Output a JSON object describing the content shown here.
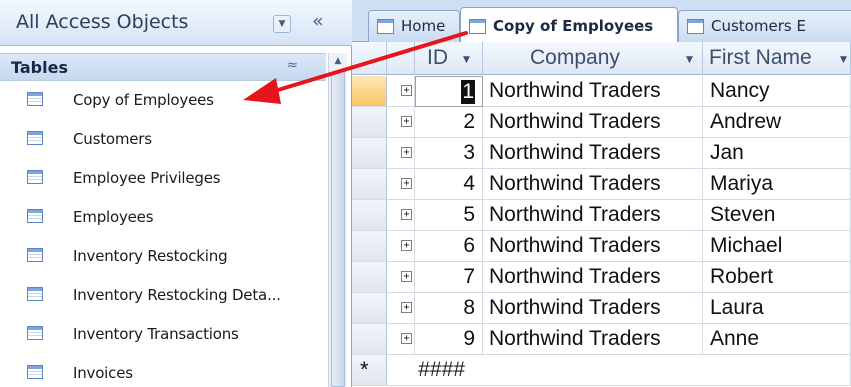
{
  "nav": {
    "title": "All Access Objects",
    "dropdown_glyph": "▼",
    "collapse_glyph": "«",
    "group": {
      "title": "Tables",
      "toggle_glyph": "≈"
    },
    "items": [
      {
        "label": "Copy of Employees"
      },
      {
        "label": "Customers"
      },
      {
        "label": "Employee Privileges"
      },
      {
        "label": "Employees"
      },
      {
        "label": "Inventory Restocking"
      },
      {
        "label": "Inventory Restocking Deta..."
      },
      {
        "label": "Inventory Transactions"
      },
      {
        "label": "Invoices"
      }
    ]
  },
  "tabs": [
    {
      "label": "Home"
    },
    {
      "label": "Copy of Employees",
      "active": true
    },
    {
      "label": "Customers E"
    }
  ],
  "datasheet": {
    "columns": [
      {
        "label": "ID"
      },
      {
        "label": "Company"
      },
      {
        "label": "First Name"
      }
    ],
    "rows": [
      {
        "id": "1",
        "company": "Northwind Traders",
        "first_name": "Nancy"
      },
      {
        "id": "2",
        "company": "Northwind Traders",
        "first_name": "Andrew"
      },
      {
        "id": "3",
        "company": "Northwind Traders",
        "first_name": "Jan"
      },
      {
        "id": "4",
        "company": "Northwind Traders",
        "first_name": "Mariya"
      },
      {
        "id": "5",
        "company": "Northwind Traders",
        "first_name": "Steven"
      },
      {
        "id": "6",
        "company": "Northwind Traders",
        "first_name": "Michael"
      },
      {
        "id": "7",
        "company": "Northwind Traders",
        "first_name": "Robert"
      },
      {
        "id": "8",
        "company": "Northwind Traders",
        "first_name": "Laura"
      },
      {
        "id": "9",
        "company": "Northwind Traders",
        "first_name": "Anne"
      }
    ],
    "new_row": {
      "marker": "*",
      "id_placeholder": "####"
    },
    "current_row_index": 0
  },
  "colors": {
    "annotation_arrow": "#e8141c",
    "current_row_selector": "#f7c766",
    "nav_header": "#d6e4f6"
  },
  "icons": {
    "nav_item": "table-icon",
    "expand": "plus-box-icon",
    "annotation": "red-arrow-icon"
  }
}
